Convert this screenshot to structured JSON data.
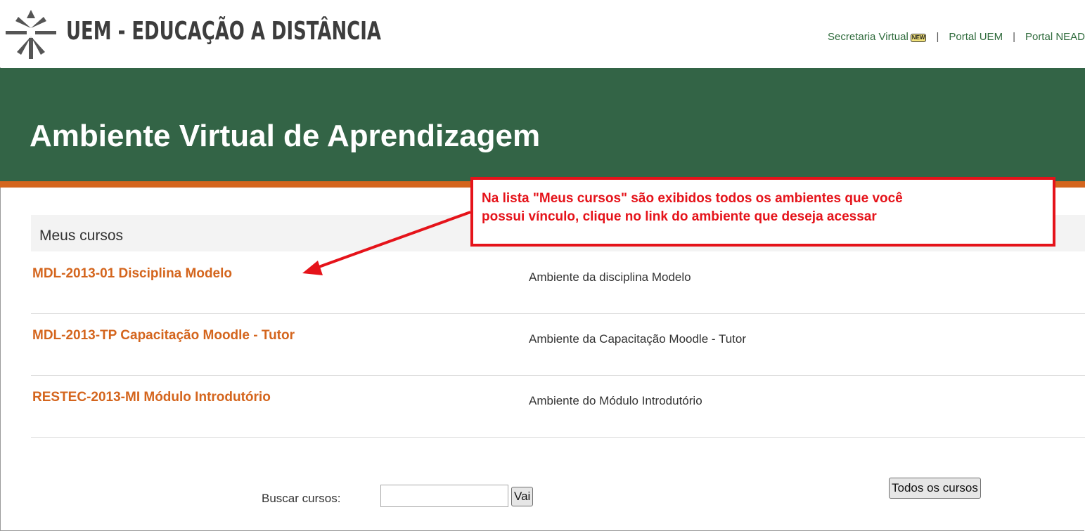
{
  "header": {
    "site_title": "UEM - EDUCAÇÃO A DISTÂNCIA",
    "links": [
      {
        "label": "Secretaria Virtual",
        "badge": "NEW"
      },
      {
        "label": "Portal UEM"
      },
      {
        "label": "Portal NEAD"
      }
    ],
    "separator": "|"
  },
  "banner": {
    "title": "Ambiente Virtual de Aprendizagem"
  },
  "courses": {
    "header": "Meus cursos",
    "items": [
      {
        "name": "MDL-2013-01 Disciplina Modelo",
        "description": "Ambiente da disciplina Modelo"
      },
      {
        "name": "MDL-2013-TP Capacitação Moodle - Tutor",
        "description": "Ambiente da Capacitação Moodle - Tutor"
      },
      {
        "name": "RESTEC-2013-MI Módulo Introdutório",
        "description": "Ambiente do Módulo Introdutório"
      }
    ]
  },
  "search": {
    "label": "Buscar cursos:",
    "value": "",
    "button": "Vai"
  },
  "all_courses_button": "Todos os cursos",
  "annotation": {
    "line1": "Na lista \"Meus cursos\" são exibidos todos os ambientes que você",
    "line2": "possui vínculo, clique no link do ambiente que deseja acessar"
  },
  "colors": {
    "banner_green": "#336446",
    "accent_orange": "#d4651d",
    "annotation_red": "#e5131a",
    "link_green": "#2f6b3c"
  }
}
